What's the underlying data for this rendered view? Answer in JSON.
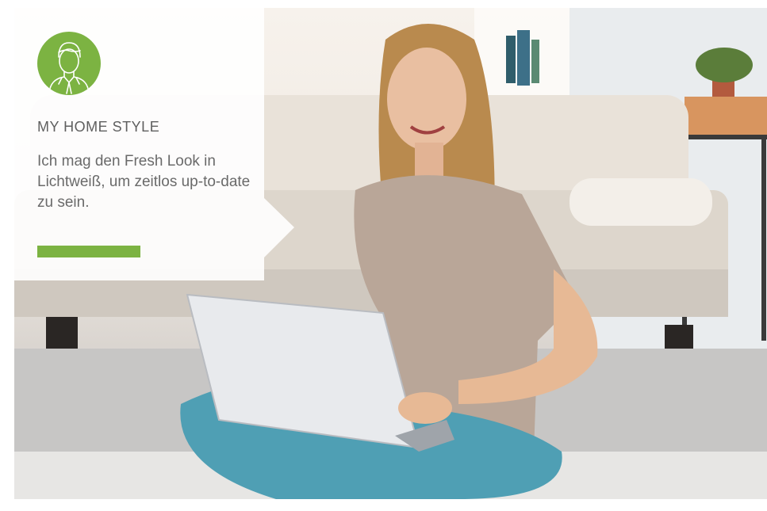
{
  "card": {
    "title": "MY HOME STYLE",
    "text": "Ich mag den Fresh Look in Lichtweiß, um zeitlos up-to-date zu sein.",
    "accent_color": "#7cb342"
  },
  "avatar": {
    "icon": "person-avatar-icon"
  },
  "photo": {
    "icon": "woman-with-laptop-photo"
  }
}
